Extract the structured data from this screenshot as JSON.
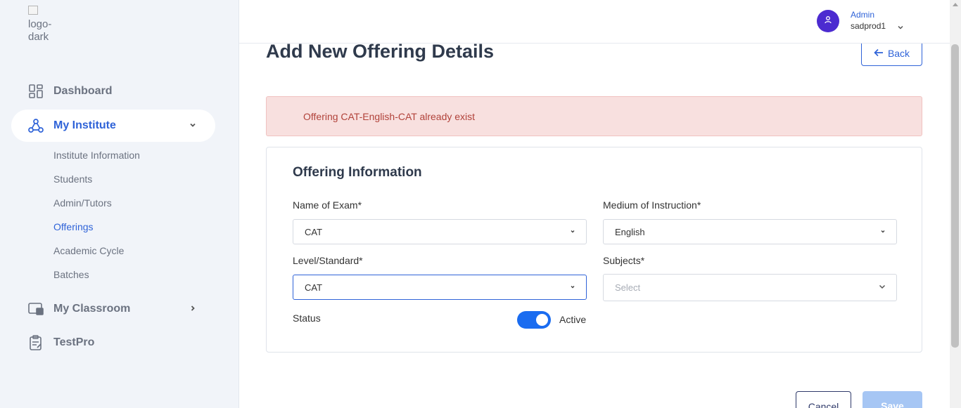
{
  "logo": {
    "alt_text": "logo-dark"
  },
  "sidebar": {
    "dashboard": "Dashboard",
    "my_institute": "My Institute",
    "sub_items": [
      "Institute Information",
      "Students",
      "Admin/Tutors",
      "Offerings",
      "Academic Cycle",
      "Batches"
    ],
    "my_classroom": "My Classroom",
    "testpro": "TestPro"
  },
  "header": {
    "user_role": "Admin",
    "user_name": "sadprod1"
  },
  "page": {
    "title": "Add New Offering Details",
    "back_label": "Back",
    "alert": "Offering CAT-English-CAT already exist"
  },
  "form": {
    "section_title": "Offering Information",
    "exam_label": "Name of Exam*",
    "exam_value": "CAT",
    "medium_label": "Medium of Instruction*",
    "medium_value": "English",
    "level_label": "Level/Standard*",
    "level_value": "CAT",
    "subjects_label": "Subjects*",
    "subjects_placeholder": "Select",
    "status_label": "Status",
    "status_value": "Active",
    "status_on": true
  },
  "actions": {
    "cancel": "Cancel",
    "save": "Save"
  },
  "colors": {
    "accent": "#2f63d8",
    "avatar": "#4c2bd0",
    "toggle": "#1a6cf0",
    "alert_bg": "#f8e0df",
    "alert_text": "#b1423a"
  },
  "icons": [
    "dashboard-icon",
    "institute-icon",
    "classroom-icon",
    "testpro-icon",
    "user-icon",
    "arrow-left-icon",
    "chevron-down-icon",
    "chevron-right-icon"
  ]
}
